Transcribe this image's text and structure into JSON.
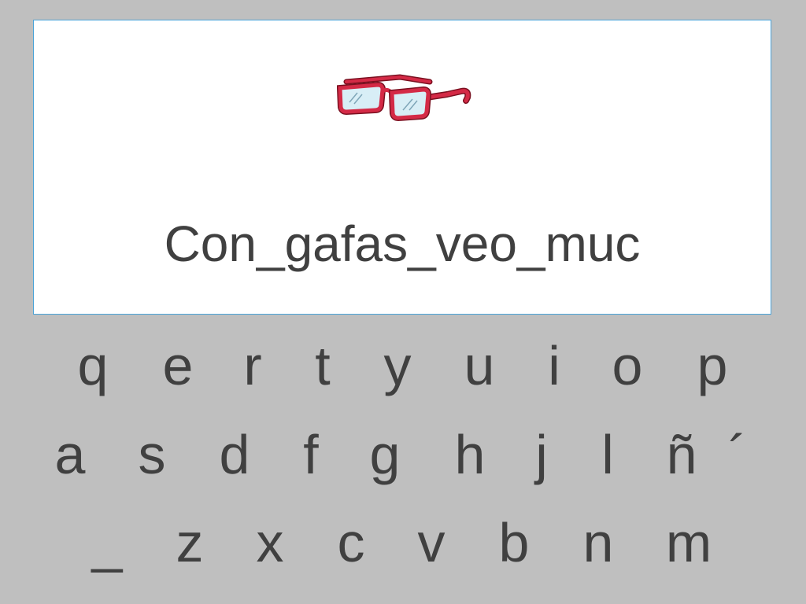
{
  "exercise": {
    "image_icon": "red-glasses-icon",
    "phrase": "Con_gafas_veo_muc"
  },
  "keyboard": {
    "row1": [
      "q",
      "e",
      "r",
      "t",
      "y",
      "u",
      "i",
      "o",
      "p"
    ],
    "row2": [
      "a",
      "s",
      "d",
      "f",
      "g",
      "h",
      "j",
      "l",
      "ñ",
      "´"
    ],
    "row3": [
      "_",
      "z",
      "x",
      "c",
      "v",
      "b",
      "n",
      "m"
    ]
  },
  "colors": {
    "background": "#bfbfbf",
    "card": "#ffffff",
    "card_border": "#4aa3d8",
    "text": "#404040",
    "glasses_frame": "#d42a46",
    "glasses_lens": "#d8eef6"
  }
}
